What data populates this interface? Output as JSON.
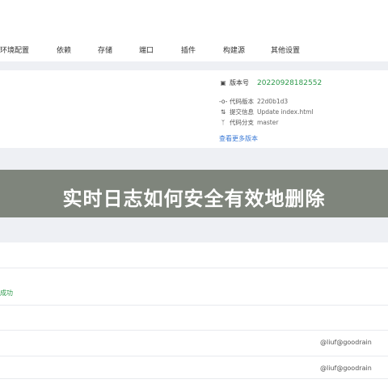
{
  "tabs": [
    "环境配置",
    "依赖",
    "存储",
    "端口",
    "插件",
    "构建源",
    "其他设置"
  ],
  "version_panel": {
    "version_label": "版本号",
    "version_value": "20220928182552",
    "commit_label": "代码版本",
    "commit_value": "22d0b1d3",
    "message_label": "提交信息",
    "message_value": "Update index.html",
    "branch_label": "代码分支",
    "branch_value": "master",
    "more_link": "查看更多版本"
  },
  "banner": {
    "title": "实时日志如何安全有效地删除"
  },
  "list": {
    "status_text": "成功",
    "rows": [
      {
        "author": "@liuf@goodrain"
      },
      {
        "author": "@liuf@goodrain"
      }
    ]
  },
  "colors": {
    "accent_green": "#2e9a4c",
    "link_blue": "#3b7ad6",
    "banner_bg": "#7f857c",
    "band_bg": "#eef0f4"
  },
  "icons": {
    "version": "camera-icon",
    "commit": "commit-icon",
    "message": "pull-request-icon",
    "branch": "branch-icon"
  }
}
